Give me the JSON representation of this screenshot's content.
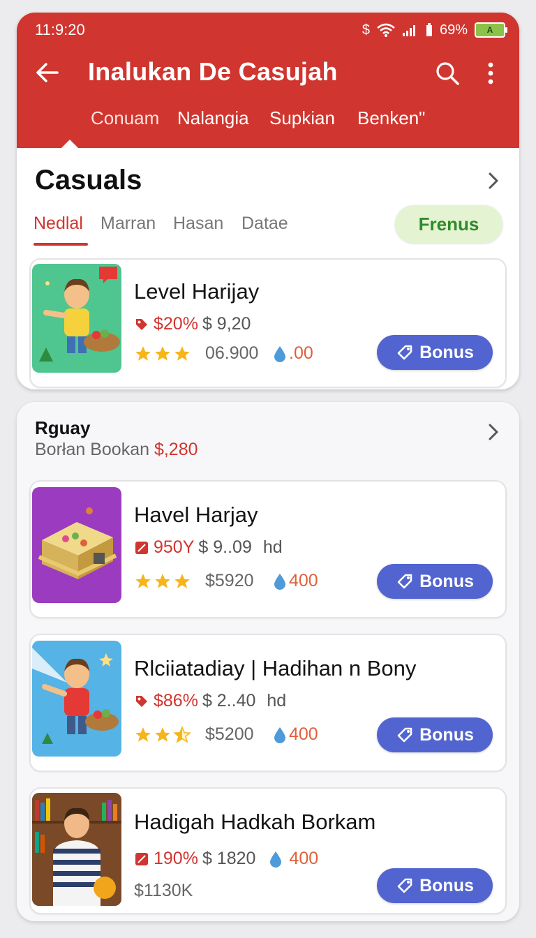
{
  "status_bar": {
    "time": "11:9:20",
    "currency": "$",
    "battery_pct": "69%",
    "battery_label": "A"
  },
  "header": {
    "title": "Inalukan De Casujah",
    "tabs": [
      "Conuam",
      "Nalangia",
      "Supkian",
      "Benken\""
    ]
  },
  "section": {
    "title": "Casuals",
    "filters": [
      "Nedlal",
      "Marran",
      "Hasan",
      "Datae"
    ],
    "pill": "Frenus"
  },
  "featured_item": {
    "title": "Level Harijay",
    "discount": "$20%",
    "price": "$ 9,20",
    "stars": 3,
    "count": "06.900",
    "gems": ".00",
    "bonus": "Bonus"
  },
  "panel2": {
    "title": "Rguay",
    "subtitle_prefix": "Borłan Bookan ",
    "subtitle_value": "$,280",
    "items": [
      {
        "title": "Havel Harjay",
        "discount": "950Y",
        "price": "$ 9..09",
        "suffix": "hd",
        "stars": 3,
        "count": "$5920",
        "gems": "400",
        "bonus": "Bonus"
      },
      {
        "title": "Rlciiatadiay | Hadihan n Bony",
        "discount": "$86%",
        "price": "$ 2..40",
        "suffix": "hd",
        "stars": 2.5,
        "count": "$5200",
        "gems": "400",
        "bonus": "Bonus"
      },
      {
        "title": "Hadigah Hadkah Borkam",
        "discount": "190%",
        "price": "$ 1820",
        "gems": "400",
        "extra": "$1130K",
        "bonus": "Bonus"
      }
    ]
  }
}
